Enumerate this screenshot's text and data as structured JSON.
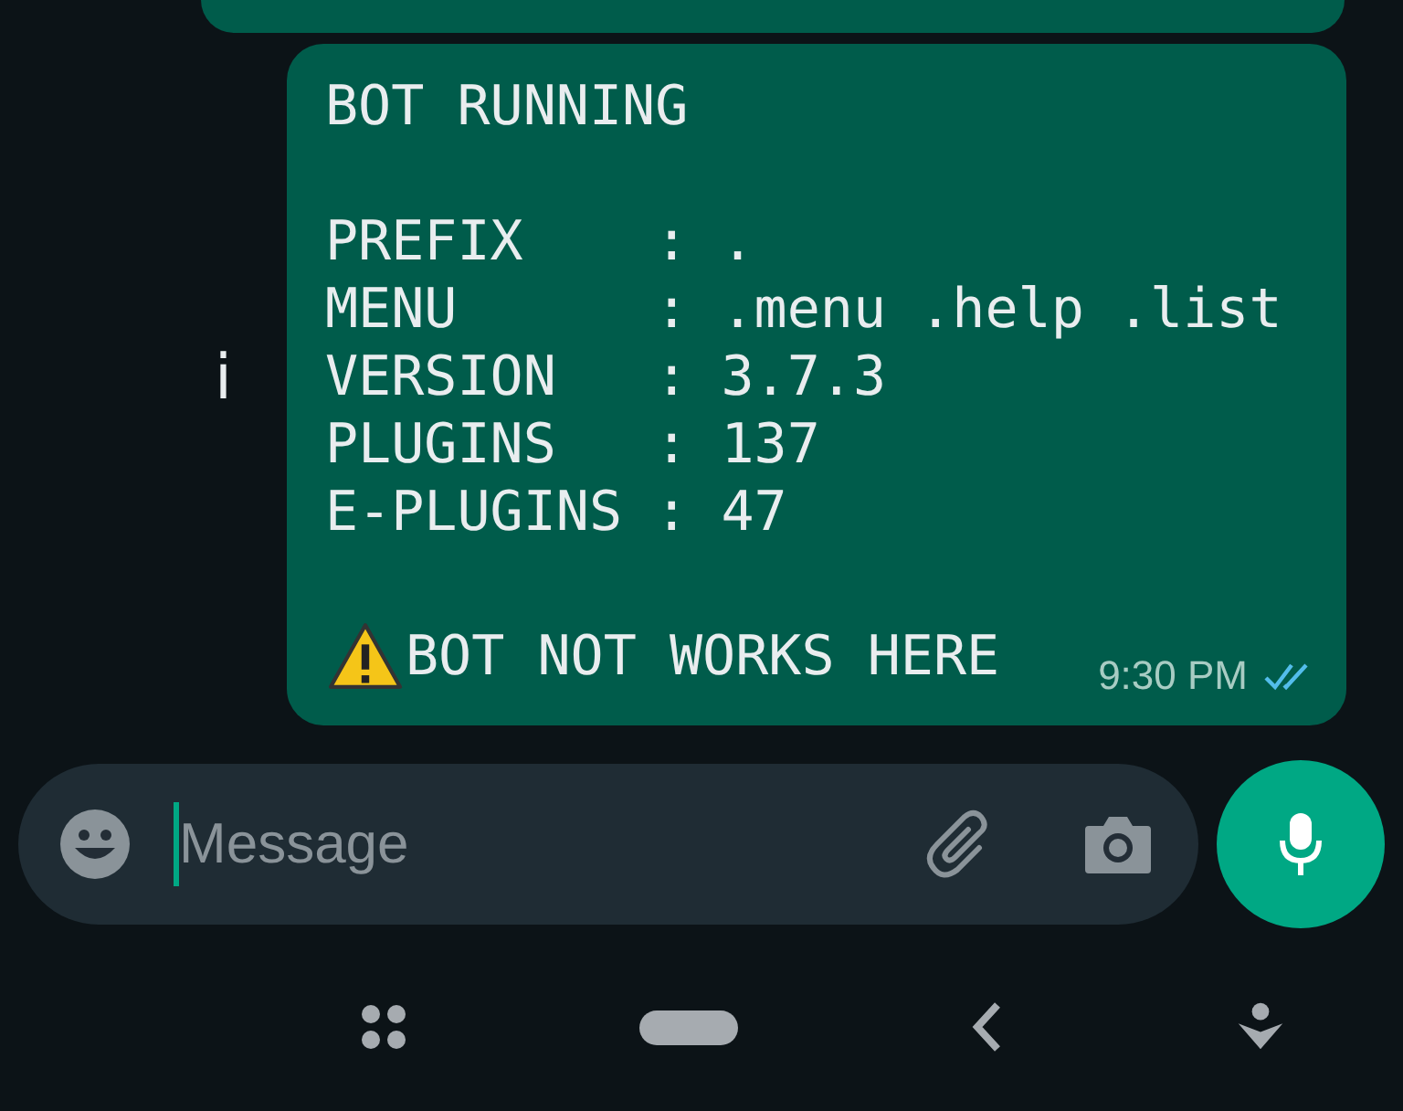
{
  "side_mark": "i",
  "message": {
    "title": "BOT RUNNING",
    "lines": [
      "PREFIX    : .",
      "MENU      : .menu .help .list",
      "VERSION   : 3.7.3",
      "PLUGINS   : 137",
      "E-PLUGINS : 47"
    ],
    "warning_text": "BOT NOT WORKS HERE",
    "time": "9:30 PM",
    "read": true
  },
  "composer": {
    "placeholder": "Message"
  }
}
